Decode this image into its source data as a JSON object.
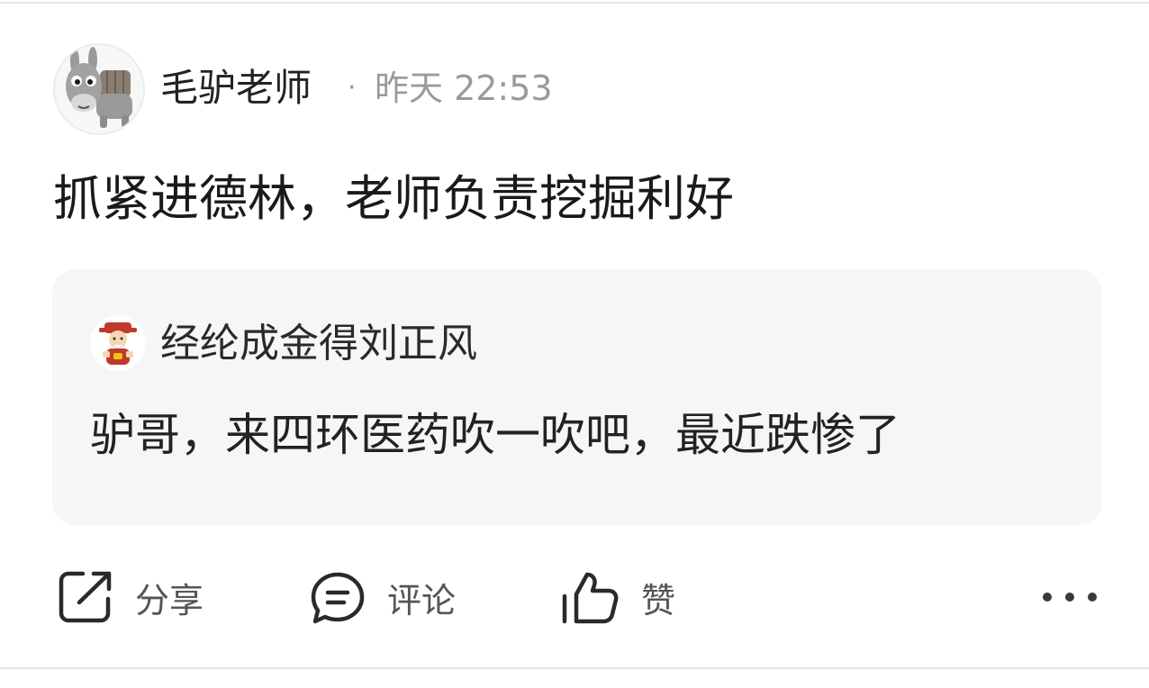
{
  "post": {
    "author": "毛驴老师",
    "separator": "·",
    "time": "昨天 22:53",
    "text": "抓紧进德林，老师负责挖掘利好",
    "author_avatar_icon": "donkey-avatar-icon"
  },
  "quote": {
    "author": "经纶成金得刘正风",
    "text": "驴哥，来四环医药吹一吹吧，最近跌惨了",
    "author_avatar_icon": "fortune-god-avatar-icon",
    "background": "#f6f6f8"
  },
  "actions": {
    "share_label": "分享",
    "comment_label": "评论",
    "like_label": "赞",
    "share_icon": "share-icon",
    "comment_icon": "comment-icon",
    "like_icon": "thumbs-up-icon",
    "more_icon": "more-icon"
  }
}
